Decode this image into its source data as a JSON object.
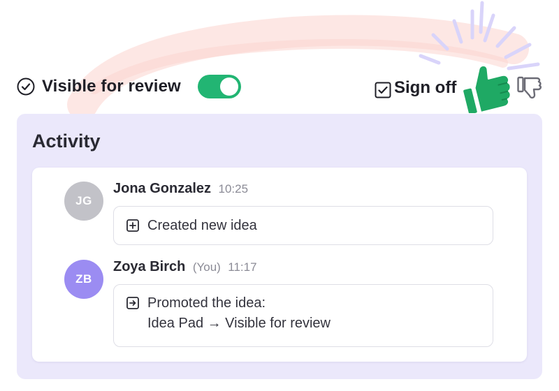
{
  "header": {
    "visible_for_review": {
      "label": "Visible for review",
      "toggle_on": true,
      "toggle_color": "#22b573"
    },
    "sign_off": {
      "label": "Sign off",
      "checked": true,
      "thumbs_up_color": "#1fa964",
      "thumbs_down_color": "#6b6b75"
    }
  },
  "activity": {
    "title": "Activity",
    "panel_color": "#ebe8fb",
    "entries": [
      {
        "initials": "JG",
        "avatar_color": "#c2c2c8",
        "author": "Jona Gonzalez",
        "you_tag": "",
        "time": "10:25",
        "icon": "plus-square-icon",
        "text_line1": "Created new idea",
        "text_line2": ""
      },
      {
        "initials": "ZB",
        "avatar_color": "#9b8cf2",
        "author": "Zoya Birch",
        "you_tag": "(You)",
        "time": "11:17",
        "icon": "arrow-right-square-icon",
        "text_line1": "Promoted the idea:",
        "text_line2": "Idea Pad → Visible for review"
      }
    ]
  }
}
